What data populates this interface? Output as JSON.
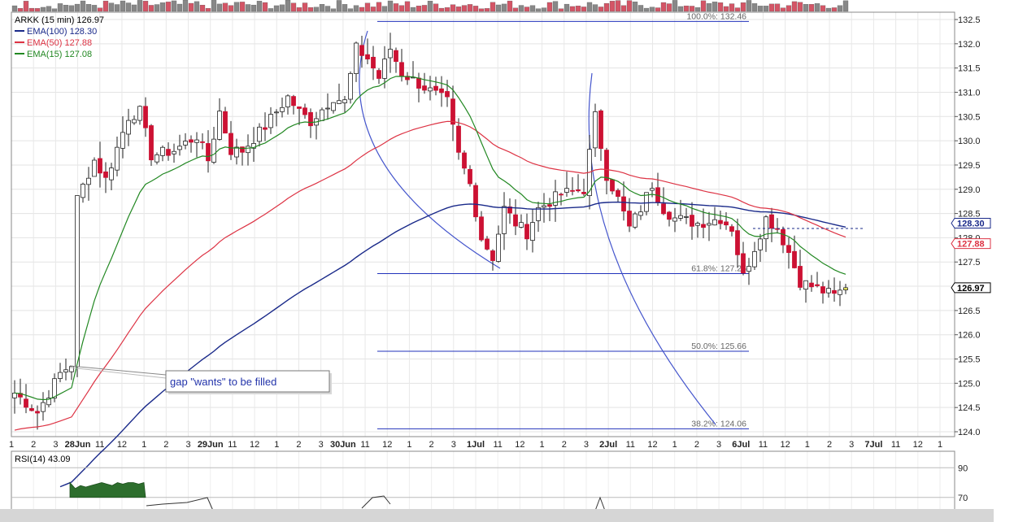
{
  "colors": {
    "up_candle": "#ffffff",
    "down_candle": "#cc1133",
    "ema100": "#1a2a8a",
    "ema50": "#dd3344",
    "ema15": "#228822",
    "fib": "#2233bb",
    "arc": "#4455cc",
    "rsi_fill": "#2d6e2d"
  },
  "chart_data": {
    "type": "candlestick",
    "title": "ARKK (15 min) 126.97",
    "legend": [
      {
        "label": "EMA(100) 128.30",
        "color": "#1a2a8a"
      },
      {
        "label": "EMA(50) 127.88",
        "color": "#dd3344"
      },
      {
        "label": "EMA(15) 127.08",
        "color": "#228822"
      }
    ],
    "y_ticks": [
      "132.5",
      "132.0",
      "131.5",
      "131.0",
      "130.5",
      "130.0",
      "129.5",
      "129.0",
      "128.5",
      "128.0",
      "127.5",
      "127.0",
      "126.5",
      "126.0",
      "125.5",
      "125.0",
      "124.5",
      "124.0"
    ],
    "ylim": [
      124.0,
      132.5
    ],
    "x_ticks": [
      {
        "label": "1",
        "bold": false
      },
      {
        "label": "2",
        "bold": false
      },
      {
        "label": "3",
        "bold": false
      },
      {
        "label": "28Jun",
        "bold": true
      },
      {
        "label": "11",
        "bold": false
      },
      {
        "label": "12",
        "bold": false
      },
      {
        "label": "1",
        "bold": false
      },
      {
        "label": "2",
        "bold": false
      },
      {
        "label": "3",
        "bold": false
      },
      {
        "label": "29Jun",
        "bold": true
      },
      {
        "label": "11",
        "bold": false
      },
      {
        "label": "12",
        "bold": false
      },
      {
        "label": "1",
        "bold": false
      },
      {
        "label": "2",
        "bold": false
      },
      {
        "label": "3",
        "bold": false
      },
      {
        "label": "30Jun",
        "bold": true
      },
      {
        "label": "11",
        "bold": false
      },
      {
        "label": "12",
        "bold": false
      },
      {
        "label": "1",
        "bold": false
      },
      {
        "label": "2",
        "bold": false
      },
      {
        "label": "3",
        "bold": false
      },
      {
        "label": "1Jul",
        "bold": true
      },
      {
        "label": "11",
        "bold": false
      },
      {
        "label": "12",
        "bold": false
      },
      {
        "label": "1",
        "bold": false
      },
      {
        "label": "2",
        "bold": false
      },
      {
        "label": "3",
        "bold": false
      },
      {
        "label": "2Jul",
        "bold": true
      },
      {
        "label": "11",
        "bold": false
      },
      {
        "label": "12",
        "bold": false
      },
      {
        "label": "1",
        "bold": false
      },
      {
        "label": "2",
        "bold": false
      },
      {
        "label": "3",
        "bold": false
      },
      {
        "label": "6Jul",
        "bold": true
      },
      {
        "label": "11",
        "bold": false
      },
      {
        "label": "12",
        "bold": false
      },
      {
        "label": "1",
        "bold": false
      },
      {
        "label": "2",
        "bold": false
      },
      {
        "label": "3",
        "bold": false
      },
      {
        "label": "7Jul",
        "bold": true
      },
      {
        "label": "11",
        "bold": false
      },
      {
        "label": "12",
        "bold": false
      },
      {
        "label": "1",
        "bold": false
      }
    ],
    "fib_levels": [
      {
        "label": "100.0%: 132.46",
        "value": 132.46
      },
      {
        "label": "61.8%: 127.26",
        "value": 127.26
      },
      {
        "label": "50.0%: 125.66",
        "value": 125.66
      },
      {
        "label": "38.2%: 124.06",
        "value": 124.06
      }
    ],
    "price_tags": [
      {
        "label": "128.30",
        "value": 128.3,
        "color": "#1a2a8a"
      },
      {
        "label": "127.88",
        "value": 127.88,
        "color": "#dd3344"
      },
      {
        "label": "126.97",
        "value": 126.97,
        "color": "#000000"
      }
    ],
    "annotation": "gap \"wants\" to be filled",
    "rsi": {
      "label": "RSI(14) 43.09",
      "ticks": [
        "90",
        "70"
      ],
      "ylim": [
        60,
        100
      ]
    },
    "candle_anchors": [
      [
        0,
        124.8
      ],
      [
        4,
        124.4
      ],
      [
        8,
        125.2
      ],
      [
        10,
        125.4
      ],
      [
        11,
        128.8
      ],
      [
        14,
        129.6
      ],
      [
        16,
        129.2
      ],
      [
        20,
        130.5
      ],
      [
        22,
        130.6
      ],
      [
        24,
        129.7
      ],
      [
        28,
        129.8
      ],
      [
        32,
        130.1
      ],
      [
        34,
        129.6
      ],
      [
        36,
        130.6
      ],
      [
        38,
        129.8
      ],
      [
        40,
        129.8
      ],
      [
        44,
        130.3
      ],
      [
        48,
        130.9
      ],
      [
        50,
        130.6
      ],
      [
        52,
        130.4
      ],
      [
        56,
        130.9
      ],
      [
        58,
        130.8
      ],
      [
        60,
        131.9
      ],
      [
        62,
        131.7
      ],
      [
        64,
        131.3
      ],
      [
        66,
        131.9
      ],
      [
        68,
        131.4
      ],
      [
        72,
        131.1
      ],
      [
        76,
        130.8
      ],
      [
        78,
        129.7
      ],
      [
        80,
        129.1
      ],
      [
        82,
        128.0
      ],
      [
        84,
        127.6
      ],
      [
        86,
        128.6
      ],
      [
        88,
        128.3
      ],
      [
        90,
        128.1
      ],
      [
        92,
        128.6
      ],
      [
        96,
        128.9
      ],
      [
        100,
        129.0
      ],
      [
        102,
        130.5
      ],
      [
        104,
        129.3
      ],
      [
        106,
        128.8
      ],
      [
        108,
        128.2
      ],
      [
        110,
        128.6
      ],
      [
        112,
        129.1
      ],
      [
        114,
        128.6
      ],
      [
        116,
        128.4
      ],
      [
        120,
        128.3
      ],
      [
        124,
        128.4
      ],
      [
        126,
        128.2
      ],
      [
        128,
        127.2
      ],
      [
        130,
        127.8
      ],
      [
        132,
        128.4
      ],
      [
        134,
        128.2
      ],
      [
        136,
        127.7
      ],
      [
        138,
        127.1
      ],
      [
        140,
        127.0
      ],
      [
        142,
        126.9
      ],
      [
        144,
        126.8
      ],
      [
        146,
        126.97
      ]
    ]
  }
}
